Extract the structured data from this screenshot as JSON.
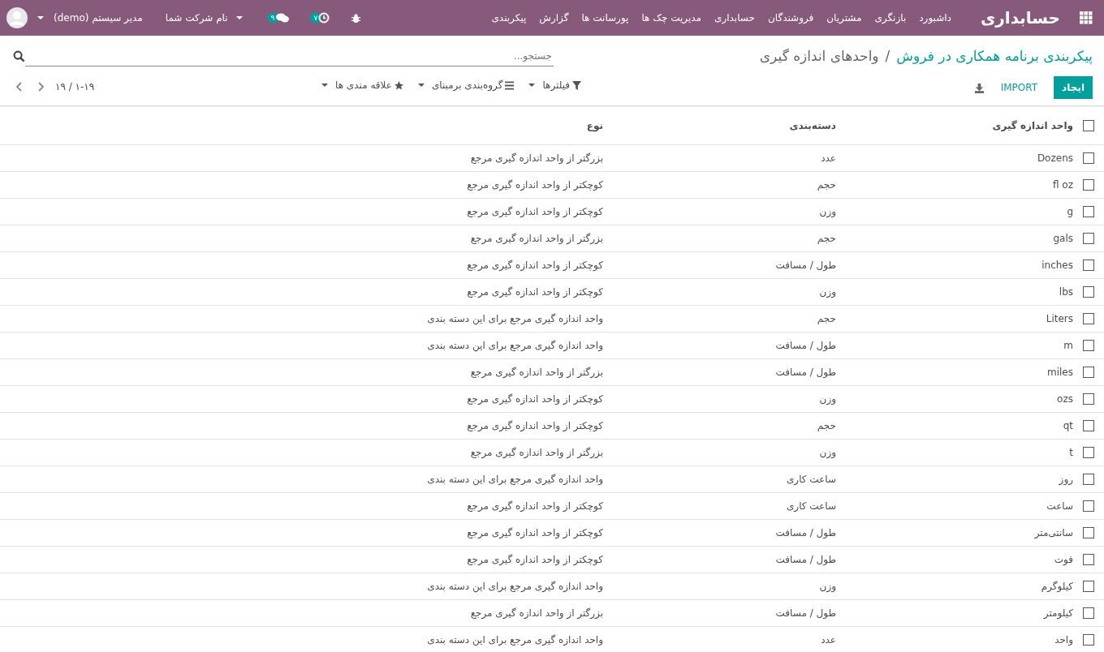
{
  "top_bar": {
    "app_title": "حسابداری",
    "menu": [
      "داشبورد",
      "بازنگری",
      "مشتریان",
      "فروشندگان",
      "حسابداری",
      "مدیریت چک ها",
      "پورسانت ها",
      "گزارش",
      "پیکربندی"
    ],
    "activity_count": "۷",
    "message_count": "۹",
    "company": "نام شرکت شما",
    "user": "مدیر سیستم (demo)"
  },
  "breadcrumb": {
    "parent": "پیکربندی برنامه همکاری در فروش",
    "separator": "/",
    "current": "واحدهای اندازه گیری"
  },
  "search": {
    "placeholder": "جستجو..."
  },
  "buttons": {
    "create": "ایجاد",
    "import": "IMPORT"
  },
  "filters": [
    "فیلترها",
    "گروه‌بندی برمبنای",
    "علاقه مندی ها"
  ],
  "pager": "۱-۱۹ / ۱۹",
  "table": {
    "select_all_checked": false,
    "columns": [
      "واحد اندازه گیری",
      "دسته‌بندی",
      "نوع"
    ],
    "rows": [
      {
        "name": "Dozens",
        "category": "عدد",
        "type": "بزرگتر از واحد اندازه گیری مرجع",
        "selected": false
      },
      {
        "name": "fl oz",
        "category": "حجم",
        "type": "کوچکتر از واحد اندازه گیری مرجع",
        "selected": false
      },
      {
        "name": "g",
        "category": "وزن",
        "type": "کوچکتر از واحد اندازه گیری مرجع",
        "selected": false
      },
      {
        "name": "gals",
        "category": "حجم",
        "type": "بزرگتر از واحد اندازه گیری مرجع",
        "selected": false
      },
      {
        "name": "inches",
        "category": "طول / مسافت",
        "type": "کوچکتر از واحد اندازه گیری مرجع",
        "selected": false
      },
      {
        "name": "lbs",
        "category": "وزن",
        "type": "کوچکتر از واحد اندازه گیری مرجع",
        "selected": false
      },
      {
        "name": "Liters",
        "category": "حجم",
        "type": "واحد اندازه گیری مرجع برای این دسته بندی",
        "selected": false
      },
      {
        "name": "m",
        "category": "طول / مسافت",
        "type": "واحد اندازه گیری مرجع برای این دسته بندی",
        "selected": false
      },
      {
        "name": "miles",
        "category": "طول / مسافت",
        "type": "بزرگتر از واحد اندازه گیری مرجع",
        "selected": false
      },
      {
        "name": "ozs",
        "category": "وزن",
        "type": "کوچکتر از واحد اندازه گیری مرجع",
        "selected": false
      },
      {
        "name": "qt",
        "category": "حجم",
        "type": "کوچکتر از واحد اندازه گیری مرجع",
        "selected": false
      },
      {
        "name": "t",
        "category": "وزن",
        "type": "بزرگتر از واحد اندازه گیری مرجع",
        "selected": false
      },
      {
        "name": "روز",
        "category": "ساعت کاری",
        "type": "واحد اندازه گیری مرجع برای این دسته بندی",
        "selected": false
      },
      {
        "name": "ساعت",
        "category": "ساعت کاری",
        "type": "کوچکتر از واحد اندازه گیری مرجع",
        "selected": false
      },
      {
        "name": "سانتی‌متر",
        "category": "طول / مسافت",
        "type": "کوچکتر از واحد اندازه گیری مرجع",
        "selected": false
      },
      {
        "name": "فوت",
        "category": "طول / مسافت",
        "type": "کوچکتر از واحد اندازه گیری مرجع",
        "selected": false
      },
      {
        "name": "کیلوگرم",
        "category": "وزن",
        "type": "واحد اندازه گیری مرجع برای این دسته بندی",
        "selected": false
      },
      {
        "name": "کیلومتر",
        "category": "طول / مسافت",
        "type": "بزرگتر از واحد اندازه گیری مرجع",
        "selected": false
      },
      {
        "name": "واحد",
        "category": "عدد",
        "type": "واحد اندازه گیری مرجع برای این دسته بندی",
        "selected": false
      }
    ]
  }
}
